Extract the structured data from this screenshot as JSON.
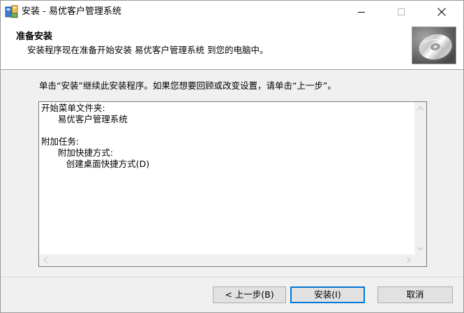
{
  "window": {
    "title": "安装 - 易优客户管理系统",
    "icon": "installer-icon"
  },
  "header": {
    "title": "准备安装",
    "subtitle": "安装程序现在准备开始安装 易优客户管理系统 到您的电脑中。",
    "image": "cd-disc-icon"
  },
  "body": {
    "intro": "单击“安装”继续此安装程序。如果您想要回顾或改变设置，请单击“上一步”。",
    "memo_lines": [
      "开始菜单文件夹:",
      "      易优客户管理系统",
      "",
      "附加任务:",
      "      附加快捷方式:",
      "         创建桌面快捷方式(D)"
    ]
  },
  "buttons": {
    "back": "< 上一步(B)",
    "install": "安装(I)",
    "cancel": "取消"
  },
  "colors": {
    "focus_border": "#0078d7",
    "face": "#f0f0f0"
  }
}
